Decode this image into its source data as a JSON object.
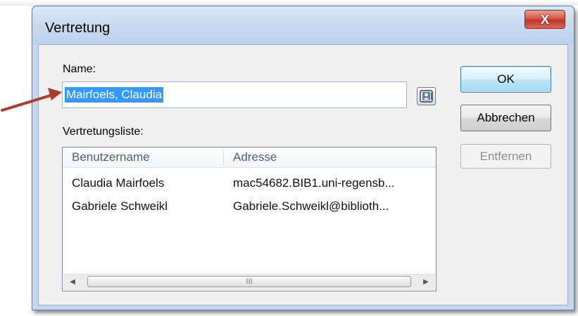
{
  "dialog": {
    "title": "Vertretung",
    "close_label": "X"
  },
  "form": {
    "name_label": "Name:",
    "name_value": "Mairfoels, Claudia",
    "list_label": "Vertretungsliste:"
  },
  "list": {
    "columns": [
      "Benutzername",
      "Adresse"
    ],
    "rows": [
      [
        "Claudia Mairfoels",
        "mac54682.BIB1.uni-regensb..."
      ],
      [
        "Gabriele Schweikl",
        "Gabriele.Schweikl@biblioth..."
      ]
    ],
    "scroll_thumb_grip": "III"
  },
  "buttons": {
    "ok": "OK",
    "cancel": "Abbrechen",
    "remove": "Entfernen"
  },
  "colors": {
    "annotation_arrow": "#b03a2e",
    "selection": "#3399ff",
    "close_button": "#c2322a"
  }
}
